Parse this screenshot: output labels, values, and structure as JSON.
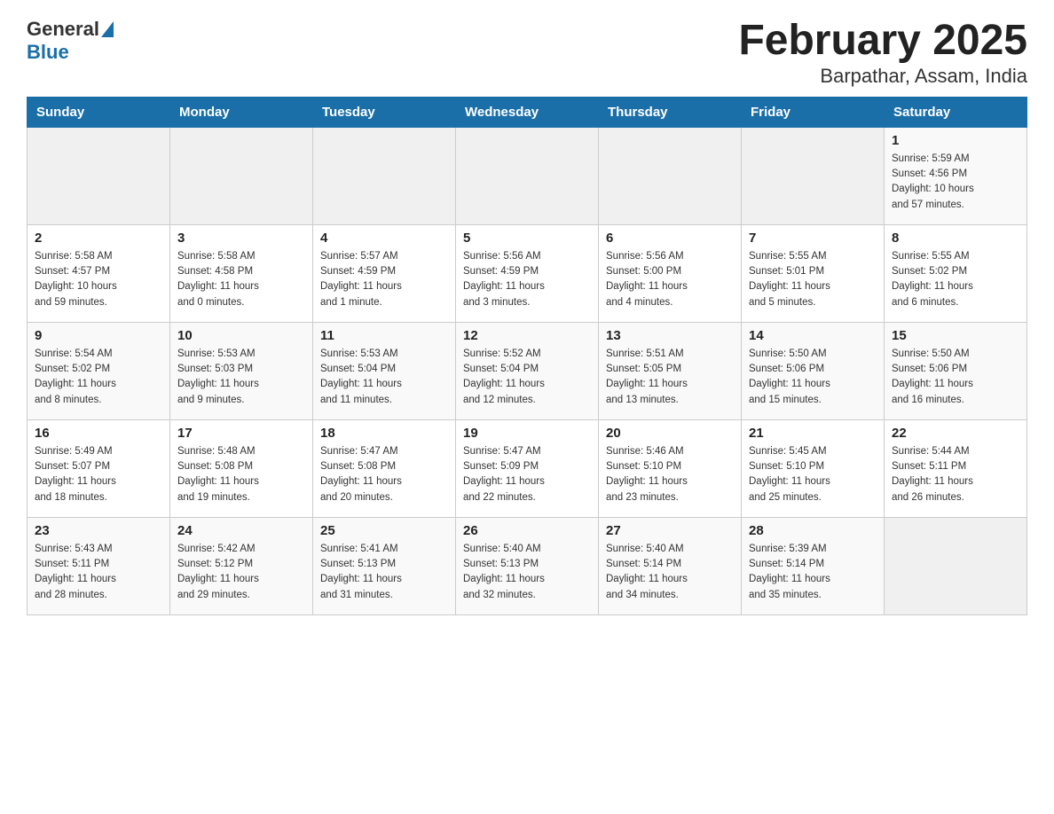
{
  "header": {
    "title": "February 2025",
    "subtitle": "Barpathar, Assam, India",
    "logo_general": "General",
    "logo_blue": "Blue"
  },
  "weekdays": [
    "Sunday",
    "Monday",
    "Tuesday",
    "Wednesday",
    "Thursday",
    "Friday",
    "Saturday"
  ],
  "weeks": [
    [
      {
        "day": "",
        "info": ""
      },
      {
        "day": "",
        "info": ""
      },
      {
        "day": "",
        "info": ""
      },
      {
        "day": "",
        "info": ""
      },
      {
        "day": "",
        "info": ""
      },
      {
        "day": "",
        "info": ""
      },
      {
        "day": "1",
        "info": "Sunrise: 5:59 AM\nSunset: 4:56 PM\nDaylight: 10 hours\nand 57 minutes."
      }
    ],
    [
      {
        "day": "2",
        "info": "Sunrise: 5:58 AM\nSunset: 4:57 PM\nDaylight: 10 hours\nand 59 minutes."
      },
      {
        "day": "3",
        "info": "Sunrise: 5:58 AM\nSunset: 4:58 PM\nDaylight: 11 hours\nand 0 minutes."
      },
      {
        "day": "4",
        "info": "Sunrise: 5:57 AM\nSunset: 4:59 PM\nDaylight: 11 hours\nand 1 minute."
      },
      {
        "day": "5",
        "info": "Sunrise: 5:56 AM\nSunset: 4:59 PM\nDaylight: 11 hours\nand 3 minutes."
      },
      {
        "day": "6",
        "info": "Sunrise: 5:56 AM\nSunset: 5:00 PM\nDaylight: 11 hours\nand 4 minutes."
      },
      {
        "day": "7",
        "info": "Sunrise: 5:55 AM\nSunset: 5:01 PM\nDaylight: 11 hours\nand 5 minutes."
      },
      {
        "day": "8",
        "info": "Sunrise: 5:55 AM\nSunset: 5:02 PM\nDaylight: 11 hours\nand 6 minutes."
      }
    ],
    [
      {
        "day": "9",
        "info": "Sunrise: 5:54 AM\nSunset: 5:02 PM\nDaylight: 11 hours\nand 8 minutes."
      },
      {
        "day": "10",
        "info": "Sunrise: 5:53 AM\nSunset: 5:03 PM\nDaylight: 11 hours\nand 9 minutes."
      },
      {
        "day": "11",
        "info": "Sunrise: 5:53 AM\nSunset: 5:04 PM\nDaylight: 11 hours\nand 11 minutes."
      },
      {
        "day": "12",
        "info": "Sunrise: 5:52 AM\nSunset: 5:04 PM\nDaylight: 11 hours\nand 12 minutes."
      },
      {
        "day": "13",
        "info": "Sunrise: 5:51 AM\nSunset: 5:05 PM\nDaylight: 11 hours\nand 13 minutes."
      },
      {
        "day": "14",
        "info": "Sunrise: 5:50 AM\nSunset: 5:06 PM\nDaylight: 11 hours\nand 15 minutes."
      },
      {
        "day": "15",
        "info": "Sunrise: 5:50 AM\nSunset: 5:06 PM\nDaylight: 11 hours\nand 16 minutes."
      }
    ],
    [
      {
        "day": "16",
        "info": "Sunrise: 5:49 AM\nSunset: 5:07 PM\nDaylight: 11 hours\nand 18 minutes."
      },
      {
        "day": "17",
        "info": "Sunrise: 5:48 AM\nSunset: 5:08 PM\nDaylight: 11 hours\nand 19 minutes."
      },
      {
        "day": "18",
        "info": "Sunrise: 5:47 AM\nSunset: 5:08 PM\nDaylight: 11 hours\nand 20 minutes."
      },
      {
        "day": "19",
        "info": "Sunrise: 5:47 AM\nSunset: 5:09 PM\nDaylight: 11 hours\nand 22 minutes."
      },
      {
        "day": "20",
        "info": "Sunrise: 5:46 AM\nSunset: 5:10 PM\nDaylight: 11 hours\nand 23 minutes."
      },
      {
        "day": "21",
        "info": "Sunrise: 5:45 AM\nSunset: 5:10 PM\nDaylight: 11 hours\nand 25 minutes."
      },
      {
        "day": "22",
        "info": "Sunrise: 5:44 AM\nSunset: 5:11 PM\nDaylight: 11 hours\nand 26 minutes."
      }
    ],
    [
      {
        "day": "23",
        "info": "Sunrise: 5:43 AM\nSunset: 5:11 PM\nDaylight: 11 hours\nand 28 minutes."
      },
      {
        "day": "24",
        "info": "Sunrise: 5:42 AM\nSunset: 5:12 PM\nDaylight: 11 hours\nand 29 minutes."
      },
      {
        "day": "25",
        "info": "Sunrise: 5:41 AM\nSunset: 5:13 PM\nDaylight: 11 hours\nand 31 minutes."
      },
      {
        "day": "26",
        "info": "Sunrise: 5:40 AM\nSunset: 5:13 PM\nDaylight: 11 hours\nand 32 minutes."
      },
      {
        "day": "27",
        "info": "Sunrise: 5:40 AM\nSunset: 5:14 PM\nDaylight: 11 hours\nand 34 minutes."
      },
      {
        "day": "28",
        "info": "Sunrise: 5:39 AM\nSunset: 5:14 PM\nDaylight: 11 hours\nand 35 minutes."
      },
      {
        "day": "",
        "info": ""
      }
    ]
  ]
}
